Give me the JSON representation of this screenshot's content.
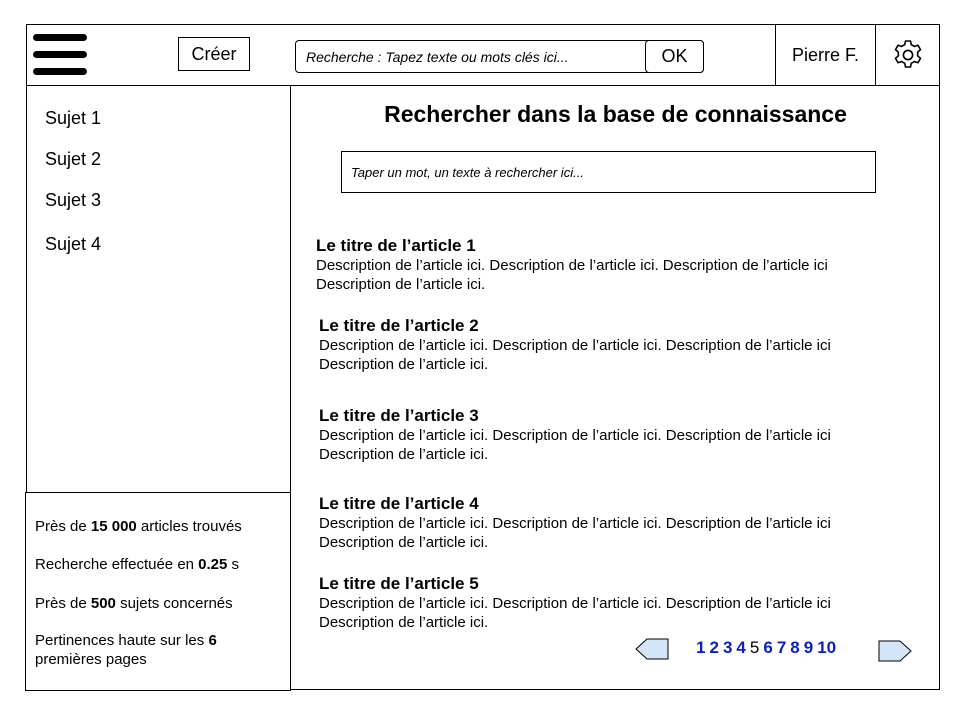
{
  "header": {
    "create_label": "Créer",
    "search_placeholder": "Recherche : Tapez texte ou mots clés ici...",
    "ok_label": "OK",
    "user_name": "Pierre F.",
    "menu_icon": "hamburger-menu-icon",
    "settings_icon": "gear-icon"
  },
  "sidebar": {
    "items": [
      {
        "label": "Sujet 1"
      },
      {
        "label": "Sujet 2"
      },
      {
        "label": "Sujet 3"
      },
      {
        "label": "Sujet 4"
      }
    ],
    "stats": {
      "found_prefix": "Près de ",
      "found_value": "15 000",
      "found_suffix": " articles trouvés",
      "time_prefix": "Recherche effectuée en ",
      "time_value": "0.25",
      "time_suffix": " s",
      "topics_prefix": "Près de ",
      "topics_value": "500",
      "topics_suffix": " sujets concernés",
      "relevance_prefix": "Pertinences haute sur les ",
      "relevance_value": "6",
      "relevance_suffix": " premières pages"
    }
  },
  "main": {
    "title": "Rechercher dans la base de connaissance",
    "search_placeholder": "Taper un mot, un texte à rechercher ici...",
    "articles": [
      {
        "title": "Le titre de l’article 1",
        "desc": "Description de l’article ici. Description de l’article ici. Description de l’article ici Description de l’article ici."
      },
      {
        "title": "Le titre de l’article 2",
        "desc": "Description de l’article ici. Description de l’article ici. Description de l’article ici Description de l’article ici."
      },
      {
        "title": "Le titre de l’article 3",
        "desc": "Description de l’article ici. Description de l’article ici. Description de l’article ici Description de l’article ici."
      },
      {
        "title": "Le titre de l’article 4",
        "desc": "Description de l’article ici. Description de l’article ici. Description de l’article ici Description de l’article ici."
      },
      {
        "title": "Le titre de l’article 5",
        "desc": "Description de l’article ici. Description de l’article ici. Description de l’article ici Description de l’article ici."
      }
    ]
  },
  "pagination": {
    "pages": [
      "1",
      "2",
      "3",
      "4",
      "5",
      "6",
      "7",
      "8",
      "9",
      "10"
    ],
    "current": "5",
    "link_color": "#0b20c4",
    "arrow_fill": "#d4e5f7"
  }
}
